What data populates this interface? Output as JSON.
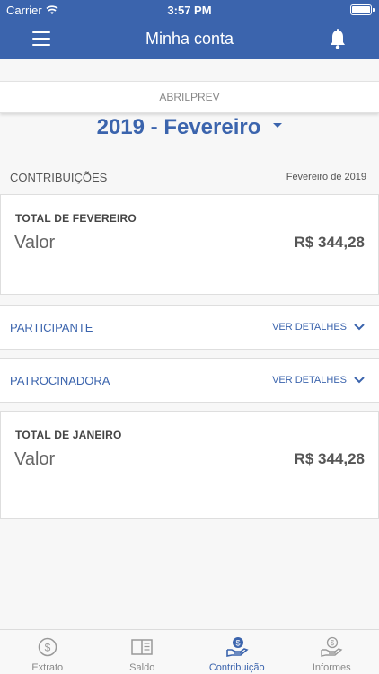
{
  "status_bar": {
    "carrier": "Carrier",
    "time": "3:57 PM"
  },
  "nav": {
    "title": "Minha conta"
  },
  "subheader": {
    "label": "ABRILPREV"
  },
  "period": {
    "label": "2019 - Fevereiro"
  },
  "section": {
    "title": "CONTRIBUIÇÕES",
    "date": "Fevereiro de 2019"
  },
  "card_fevereiro": {
    "label": "TOTAL DE FEVEREIRO",
    "valor_label": "Valor",
    "amount": "R$ 344,28"
  },
  "participante": {
    "label": "PARTICIPANTE",
    "details": "VER DETALHES"
  },
  "patrocinadora": {
    "label": "PATROCINADORA",
    "details": "VER DETALHES"
  },
  "card_janeiro": {
    "label": "TOTAL DE JANEIRO",
    "valor_label": "Valor",
    "amount": "R$ 344,28"
  },
  "tabs": [
    {
      "label": "Extrato",
      "icon": "dollar-coin-icon"
    },
    {
      "label": "Saldo",
      "icon": "ledger-book-icon"
    },
    {
      "label": "Contribuição",
      "icon": "hand-coin-icon",
      "active": true
    },
    {
      "label": "Informes",
      "icon": "hand-dollar-icon"
    }
  ],
  "colors": {
    "primary": "#3b64ad",
    "background": "#f7f7f7"
  }
}
